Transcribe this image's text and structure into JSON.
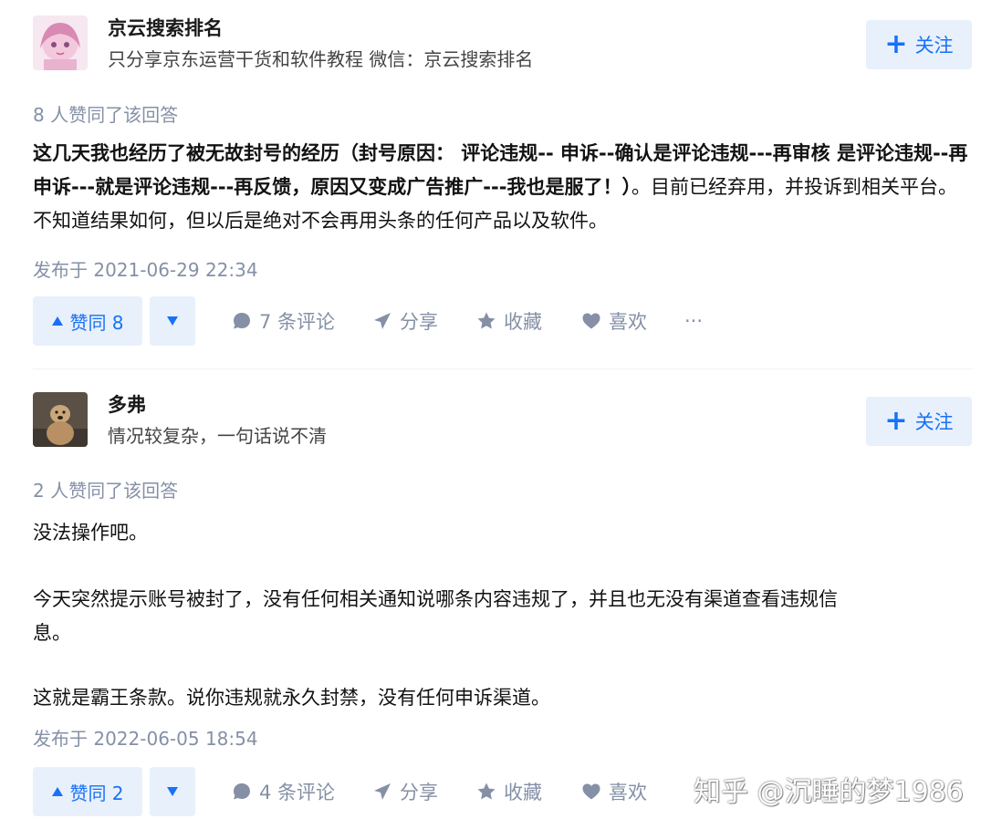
{
  "answers": [
    {
      "author_name": "京云搜索排名",
      "author_bio": "只分享京东运营干货和软件教程 微信：京云搜索排名",
      "follow_label": "关注",
      "voters_text": "8 人赞同了该回答",
      "content_bold": "这几天我也经历了被无故封号的经历（封号原因： 评论违规-- 申诉--确认是评论违规---再审核 是评论违规--再申诉---就是评论违规---再反馈，原因又变成广告推广---我也是服了！）",
      "content_normal": "。目前已经弃用，并投诉到相关平台。不知道结果如何，但以后是绝对不会再用头条的任何产品以及软件。",
      "published": "发布于 2021-06-29 22:34",
      "vote_label": "赞同 8",
      "comments_label": "7 条评论",
      "share_label": "分享",
      "collect_label": "收藏",
      "like_label": "喜欢",
      "more_label": "···"
    },
    {
      "author_name": "多弗",
      "author_bio": "情况较复杂，一句话说不清",
      "follow_label": "关注",
      "voters_text": "2 人赞同了该回答",
      "paragraphs": [
        "没法操作吧。",
        "今天突然提示账号被封了，没有任何相关通知说哪条内容违规了，并且也无没有渠道查看违规信",
        "息。",
        "这就是霸王条款。说你违规就永久封禁，没有任何申诉渠道。"
      ],
      "published": "发布于 2022-06-05 18:54",
      "vote_label": "赞同 2",
      "comments_label": "4 条评论",
      "share_label": "分享",
      "collect_label": "收藏",
      "like_label": "喜欢"
    }
  ],
  "watermark": "知乎 @沉睡的梦1986",
  "colors": {
    "accent": "#1772f6",
    "accent_bg": "#e8f0fc",
    "muted": "#8590a6"
  },
  "icons": [
    "plus-icon",
    "triangle-up-icon",
    "triangle-down-icon",
    "comment-icon",
    "share-icon",
    "star-icon",
    "heart-icon",
    "more-icon"
  ]
}
